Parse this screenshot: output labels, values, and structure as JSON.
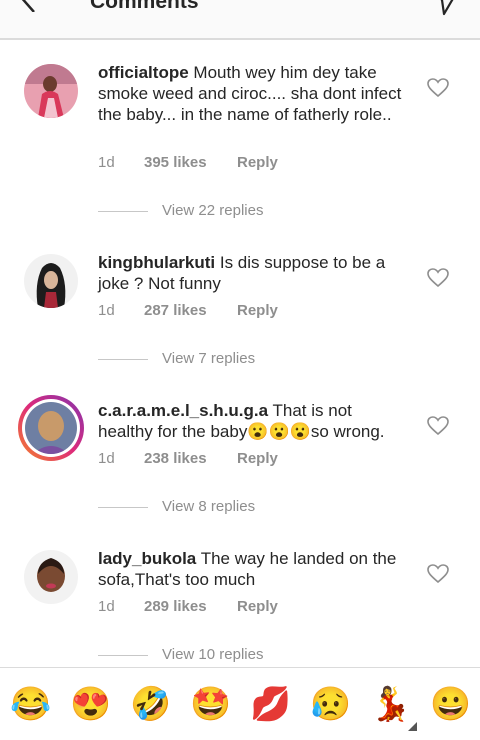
{
  "header": {
    "title": "Comments",
    "back_icon": "arrow-left-icon",
    "send_icon": "send-icon"
  },
  "comments": [
    {
      "username": "officialtope",
      "text": "Mouth wey him dey take smoke  weed and ciroc.... sha dont infect the baby... in the name of fatherly role..",
      "time": "1d",
      "likes": "395 likes",
      "reply": "Reply",
      "view_replies": "View 22 replies"
    },
    {
      "username": "kingbhularkuti",
      "text": "Is dis suppose to be a joke ? Not funny",
      "time": "1d",
      "likes": "287 likes",
      "reply": "Reply",
      "view_replies": "View 7 replies"
    },
    {
      "username": "c.a.r.a.m.e.l_s.h.u.g.a",
      "text": "That is not healthy for the baby😮😮😮so wrong.",
      "time": "1d",
      "likes": "238 likes",
      "reply": "Reply",
      "view_replies": "View 8 replies"
    },
    {
      "username": "lady_bukola",
      "text": "The way he landed on the sofa,That's too much",
      "time": "1d",
      "likes": "289 likes",
      "reply": "Reply",
      "view_replies": "View 10 replies"
    }
  ],
  "emoji_bar": [
    "😂",
    "😍",
    "🤣",
    "🤩",
    "💋",
    "😥",
    "💃",
    "😀"
  ],
  "colors": {
    "secondary_text": "#8e8e8e",
    "divider": "#dbdbdb",
    "story_ring": "#dd2a7b"
  }
}
